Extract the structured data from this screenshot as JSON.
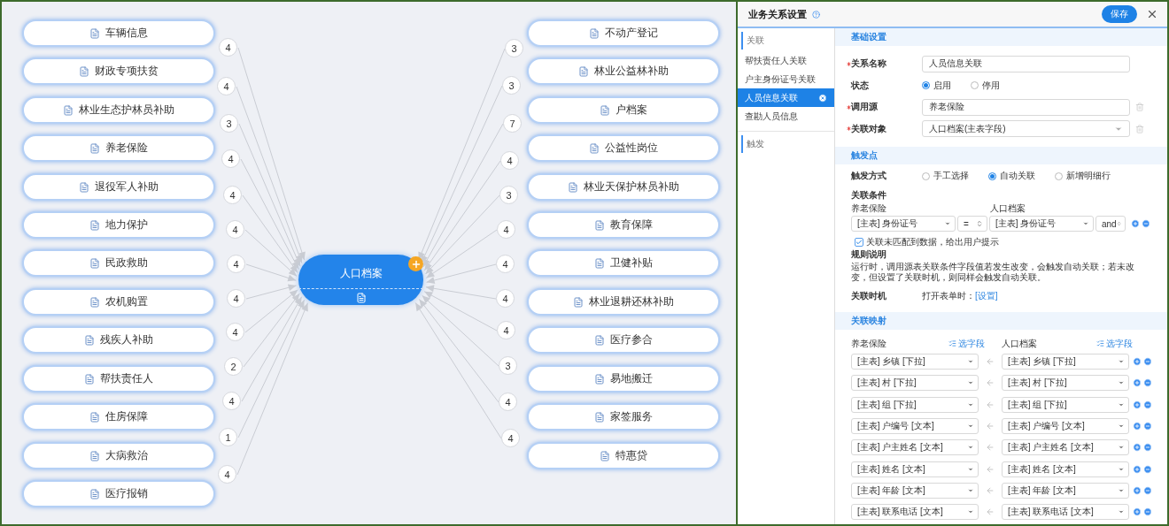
{
  "diagram": {
    "center": {
      "label": "人口档案"
    },
    "left_nodes": [
      {
        "label": "车辆信息",
        "count": "4"
      },
      {
        "label": "财政专项扶贫",
        "count": "4"
      },
      {
        "label": "林业生态护林员补助",
        "count": "3"
      },
      {
        "label": "养老保险",
        "count": "4"
      },
      {
        "label": "退役军人补助",
        "count": "4"
      },
      {
        "label": "地力保护",
        "count": "4"
      },
      {
        "label": "民政救助",
        "count": "4"
      },
      {
        "label": "农机购置",
        "count": "4"
      },
      {
        "label": "残疾人补助",
        "count": "4"
      },
      {
        "label": "帮扶责任人",
        "count": "2"
      },
      {
        "label": "住房保障",
        "count": "4"
      },
      {
        "label": "大病救治",
        "count": "1"
      },
      {
        "label": "医疗报销",
        "count": "4"
      }
    ],
    "right_nodes": [
      {
        "label": "不动产登记",
        "count": "3"
      },
      {
        "label": "林业公益林补助",
        "count": "3"
      },
      {
        "label": "户档案",
        "count": "7"
      },
      {
        "label": "公益性岗位",
        "count": "4"
      },
      {
        "label": "林业天保护林员补助",
        "count": "3"
      },
      {
        "label": "教育保障",
        "count": "4"
      },
      {
        "label": "卫健补贴",
        "count": "4"
      },
      {
        "label": "林业退耕还林补助",
        "count": "4"
      },
      {
        "label": "医疗参合",
        "count": "4"
      },
      {
        "label": "易地搬迁",
        "count": "3"
      },
      {
        "label": "家签服务",
        "count": "4"
      },
      {
        "label": "特惠贷",
        "count": "4"
      }
    ]
  },
  "panel": {
    "title": "业务关系设置",
    "save_button": "保存",
    "sidebar": [
      {
        "label": "关联",
        "items": [
          {
            "label": "帮扶责任人关联",
            "selected": false
          },
          {
            "label": "户主身份证号关联",
            "selected": false
          },
          {
            "label": "人员信息关联",
            "selected": true
          },
          {
            "label": "查勘人员信息",
            "selected": false
          }
        ]
      },
      {
        "label": "触发"
      }
    ],
    "basic": {
      "title": "基础设置",
      "fields": [
        {
          "kind": "input",
          "label": "关系名称",
          "required": true,
          "deletable": false,
          "value": "人员信息关联"
        },
        {
          "kind": "radio",
          "label": "状态",
          "required": false,
          "deletable": false,
          "options": [
            {
              "label": "启用",
              "selected": true
            },
            {
              "label": "停用",
              "selected": false
            }
          ]
        },
        {
          "kind": "input",
          "label": "调用源",
          "required": true,
          "deletable": true,
          "value": "养老保险"
        },
        {
          "kind": "select",
          "label": "关联对象",
          "required": true,
          "deletable": true,
          "value": "人口档案(主表字段)"
        }
      ]
    },
    "trigger": {
      "title": "触发点",
      "mode": {
        "label": "触发方式",
        "options": [
          {
            "label": "手工选择",
            "selected": false
          },
          {
            "label": "自动关联",
            "selected": true
          },
          {
            "label": "新增明细行",
            "selected": false
          }
        ]
      },
      "condition": {
        "title": "关联条件",
        "source": "养老保险",
        "target": "人口档案",
        "source_field": "[主表] 身份证号",
        "operator": "=",
        "target_field": "[主表] 身份证号",
        "joiner": "and"
      },
      "notify": {
        "label": "关联未匹配到数据，给出用户提示",
        "checked": true
      },
      "rule": {
        "title": "规则说明",
        "text": "运行时，调用源表关联条件字段值若发生改变，会触发自动关联；若未改变，但设置了关联时机，则同样会触发自动关联。"
      },
      "timing": {
        "label": "关联时机",
        "text": "打开表单时：",
        "link": "[设置]"
      }
    },
    "mapping": {
      "title": "关联映射",
      "source": "养老保险",
      "source_pick": "选字段",
      "target": "人口档案",
      "target_pick": "选字段",
      "rows": [
        {
          "source": "[主表] 乡镇 [下拉]",
          "target": "[主表] 乡镇 [下拉]"
        },
        {
          "source": "[主表] 村 [下拉]",
          "target": "[主表] 村 [下拉]"
        },
        {
          "source": "[主表] 组 [下拉]",
          "target": "[主表] 组 [下拉]"
        },
        {
          "source": "[主表] 户编号 [文本]",
          "target": "[主表] 户编号 [文本]"
        },
        {
          "source": "[主表] 户主姓名 [文本]",
          "target": "[主表] 户主姓名 [文本]"
        },
        {
          "source": "[主表] 姓名 [文本]",
          "target": "[主表] 姓名 [文本]"
        },
        {
          "source": "[主表] 年龄 [文本]",
          "target": "[主表] 年龄 [文本]"
        },
        {
          "source": "[主表] 联系电话 [文本]",
          "target": "[主表] 联系电话 [文本]"
        }
      ]
    }
  }
}
